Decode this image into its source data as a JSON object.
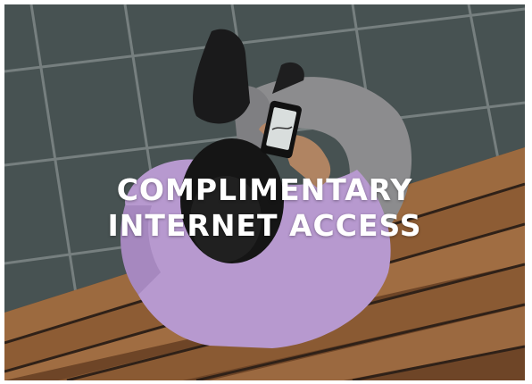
{
  "promo": {
    "headline_line1": "COMPLIMENTARY",
    "headline_line2": "INTERNET ACCESS",
    "image_subject": "man-sitting-on-bench-using-phone"
  },
  "colors": {
    "text": "#ffffff",
    "tile": "#4a5555",
    "grout": "#7c8484",
    "bench": "#8a5a34",
    "shirt": "#b89ad0",
    "trousers": "#8a8a8c"
  }
}
